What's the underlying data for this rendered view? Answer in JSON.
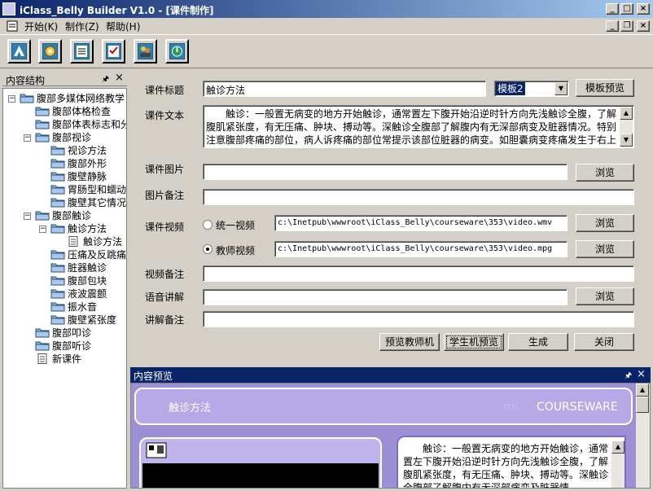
{
  "window": {
    "title": "iClass_Belly Builder V1.0  - [课件制作]",
    "min_label": "_",
    "max_label": "□",
    "close_label": "×"
  },
  "menu": {
    "items": [
      "开始(K)",
      "制作(Z)",
      "帮助(H)"
    ],
    "mdi_min": "_",
    "mdi_restore": "❐",
    "mdi_close": "×"
  },
  "toolbar": {
    "tools": [
      "arrow-up-icon",
      "gear-icon",
      "list-icon",
      "checklist-icon",
      "people-icon",
      "power-icon"
    ]
  },
  "left_panel": {
    "title": "内容结构",
    "pin": "🖈",
    "close": "×",
    "tree": [
      {
        "label": "腹部多媒体网络教学",
        "level": 0,
        "type": "folder",
        "expander": "−"
      },
      {
        "label": "腹部体格检查",
        "level": 1,
        "type": "folder"
      },
      {
        "label": "腹部体表标志和分",
        "level": 1,
        "type": "folder"
      },
      {
        "label": "腹部视诊",
        "level": 1,
        "type": "folder",
        "expander": "−"
      },
      {
        "label": "视诊方法",
        "level": 2,
        "type": "folder"
      },
      {
        "label": "腹部外形",
        "level": 2,
        "type": "folder"
      },
      {
        "label": "腹壁静脉",
        "level": 2,
        "type": "folder"
      },
      {
        "label": "胃肠型和蠕动",
        "level": 2,
        "type": "folder"
      },
      {
        "label": "腹壁其它情况",
        "level": 2,
        "type": "folder"
      },
      {
        "label": "腹部触诊",
        "level": 1,
        "type": "folder",
        "expander": "−"
      },
      {
        "label": "触诊方法",
        "level": 2,
        "type": "folder",
        "expander": "−"
      },
      {
        "label": "触诊方法",
        "level": 3,
        "type": "doc"
      },
      {
        "label": "压痛及反跳痛",
        "level": 2,
        "type": "folder"
      },
      {
        "label": "脏器触诊",
        "level": 2,
        "type": "folder"
      },
      {
        "label": "腹部包块",
        "level": 2,
        "type": "folder"
      },
      {
        "label": "液波震颤",
        "level": 2,
        "type": "folder"
      },
      {
        "label": "振水音",
        "level": 2,
        "type": "folder"
      },
      {
        "label": "腹壁紧张度",
        "level": 2,
        "type": "folder"
      },
      {
        "label": "腹部叩诊",
        "level": 1,
        "type": "folder"
      },
      {
        "label": "腹部听诊",
        "level": 1,
        "type": "folder"
      },
      {
        "label": "新课件",
        "level": 1,
        "type": "doc"
      }
    ]
  },
  "form": {
    "title_label": "课件标题",
    "title_value": "触诊方法",
    "template_value": "模板2",
    "template_preview_btn": "模板预览",
    "text_label": "课件文本",
    "text_value": "　　触诊：一般置无病变的地方开始触诊，通常置左下腹开始沿逆时针方向先浅触诊全腹，了解腹肌紧张度，有无压痛、肿块、搏动等。深触诊全腹部了解腹内有无深部病变及脏器情况。特别注意腹部疼痛的部位，病人诉疼痛的部位常提示该部位脏器的病变。如胆囊病变疼痛发生于右上腹，胰腺、十二指肠疼痛发生于上腹部，胃部疼痛发生于左上腹，脾脏疼痛发生于左季肋部，肾",
    "image_label": "课件图片",
    "image_value": "",
    "browse": "浏览",
    "image_note_label": "图片备注",
    "image_note_value": "",
    "video_label": "课件视频",
    "video_options": [
      {
        "label": "统一视频",
        "selected": false,
        "path": "c:\\Inetpub\\wwwroot\\iClass_Belly\\courseware\\353\\video.wmv"
      },
      {
        "label": "教师视频",
        "selected": true,
        "path": "c:\\Inetpub\\wwwroot\\iClass_Belly\\courseware\\353\\video.mpg"
      }
    ],
    "video_note_label": "视频备注",
    "video_note_value": "",
    "voice_label": "语音讲解",
    "voice_value": "",
    "explain_note_label": "讲解备注",
    "explain_note_value": "",
    "buttons": [
      "预览教师机",
      "学生机预览",
      "生成",
      "关闭"
    ]
  },
  "preview": {
    "title": "内容预览",
    "pin": "🖈",
    "close": "×",
    "slide_title": "触诊方法",
    "brand": "COURSEWARE",
    "brand_faint": "mi",
    "body_text": "　　触诊：一般置无病变的地方开始触诊，通常置左下腹开始沿逆时针方向先浅触诊全腹，了解腹肌紧张度，有无压痛、肿块、搏动等。深触诊全腹部了解腹内有无深部病变及脏器情"
  },
  "colors": {
    "titlebar_start": "#0a246a",
    "titlebar_end": "#a6caf0",
    "face": "#d4d0c8",
    "slide_purple": "#b7a8e8",
    "slide_dark": "#7d6bc4"
  }
}
